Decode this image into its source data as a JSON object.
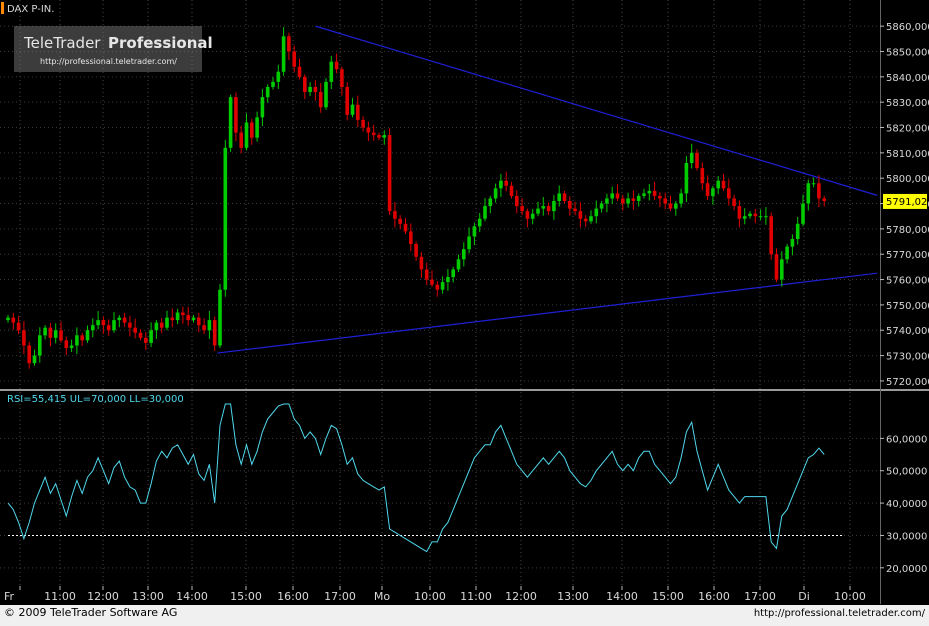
{
  "header": {
    "symbol": "DAX P-IN."
  },
  "logo": {
    "brand": "TeleTrader",
    "product": "Professional",
    "url": "http://professional.teletrader.com/"
  },
  "footer": {
    "copyright": "© 2009 TeleTrader Software AG",
    "url": "http://professional.teletrader.com/"
  },
  "colors": {
    "background": "#000000",
    "up": "#00cc00",
    "down": "#e00000",
    "trendline": "#1f1fd6",
    "rsi": "#4fd8ec",
    "last_price_box": "#ffff00"
  },
  "x_axis": {
    "labels": [
      "Fr",
      "11:00",
      "12:00",
      "13:00",
      "14:00",
      "15:00",
      "16:00",
      "17:00",
      "Mo",
      "10:00",
      "11:00",
      "12:00",
      "13:00",
      "14:00",
      "15:00",
      "16:00",
      "17:00",
      "Di",
      "10:00"
    ]
  },
  "chart_data": [
    {
      "type": "candlestick",
      "symbol": "DAX P-IN.",
      "ylim": [
        5718,
        5864
      ],
      "y_ticks": [
        5720,
        5730,
        5740,
        5750,
        5760,
        5770,
        5780,
        5790,
        5800,
        5810,
        5820,
        5830,
        5840,
        5850,
        5860
      ],
      "y_tick_labels": [
        "5720,000",
        "5730,000",
        "5740,000",
        "5750,000",
        "5760,000",
        "5770,000",
        "5780,000",
        "5790,000",
        "5800,000",
        "5810,000",
        "5820,000",
        "5830,000",
        "5840,000",
        "5850,000",
        "5860,000"
      ],
      "last_price": 5791.02,
      "last_price_label": "5791,02",
      "close": [
        5745,
        5743,
        5740,
        5734,
        5727,
        5730,
        5738,
        5741,
        5737,
        5740,
        5736,
        5733,
        5734,
        5738,
        5736,
        5740,
        5742,
        5744,
        5742,
        5740,
        5744,
        5745,
        5743,
        5741,
        5739,
        5737,
        5735,
        5740,
        5743,
        5741,
        5745,
        5744,
        5747,
        5746,
        5744,
        5745,
        5742,
        5740,
        5744,
        5734,
        5756,
        5812,
        5832,
        5818,
        5812,
        5822,
        5816,
        5824,
        5832,
        5836,
        5838,
        5842,
        5856,
        5850,
        5844,
        5840,
        5834,
        5836,
        5834,
        5828,
        5838,
        5846,
        5843,
        5836,
        5825,
        5829,
        5823,
        5820,
        5818,
        5817,
        5816,
        5817,
        5787,
        5784,
        5782,
        5779,
        5774,
        5769,
        5764,
        5760,
        5758,
        5756,
        5759,
        5761,
        5764,
        5768,
        5772,
        5777,
        5781,
        5784,
        5789,
        5792,
        5796,
        5799,
        5797,
        5793,
        5789,
        5787,
        5784,
        5786,
        5788,
        5789,
        5787,
        5791,
        5794,
        5791,
        5788,
        5787,
        5784,
        5783,
        5785,
        5788,
        5790,
        5792,
        5794,
        5792,
        5790,
        5792,
        5791,
        5793,
        5794,
        5795,
        5793,
        5792,
        5790,
        5788,
        5790,
        5794,
        5806,
        5810,
        5804,
        5798,
        5793,
        5796,
        5799,
        5796,
        5792,
        5789,
        5784,
        5785,
        5786,
        5785,
        5785,
        5785,
        5770,
        5760,
        5768,
        5773,
        5776,
        5782,
        5790,
        5798,
        5798,
        5792,
        5791
      ],
      "trendlines": [
        {
          "from": {
            "bar": 39.5,
            "value": 5731
          },
          "to": {
            "bar": 158,
            "value": 5761
          },
          "note": "lower support"
        },
        {
          "from": {
            "bar": 58,
            "value": 5860
          },
          "to": {
            "bar": 158,
            "value": 5797
          },
          "note": "upper resistance"
        }
      ]
    },
    {
      "type": "line",
      "indicator": "RSI",
      "legend_label": "RSI=55,415 UL=70,000 LL=30,000",
      "value": 55.415,
      "upper_level": 70,
      "lower_level": 30,
      "ylim": [
        15,
        70
      ],
      "y_ticks": [
        20,
        30,
        40,
        50,
        60
      ],
      "y_tick_labels": [
        "20,0000",
        "30,0000",
        "40,0000",
        "50,0000",
        "60,0000"
      ],
      "values": [
        40,
        38,
        34,
        29,
        34,
        40,
        44,
        48,
        43,
        46,
        41,
        36,
        42,
        47,
        43,
        48,
        50,
        54,
        50,
        46,
        51,
        53,
        48,
        45,
        44,
        40,
        40,
        46,
        53,
        56,
        54,
        57,
        58,
        55,
        52,
        55,
        49,
        47,
        52,
        40,
        64,
        80,
        72,
        58,
        52,
        58,
        52,
        56,
        62,
        66,
        68,
        70,
        76,
        72,
        66,
        64,
        60,
        62,
        60,
        55,
        60,
        64,
        63,
        58,
        52,
        54,
        49,
        47,
        46,
        45,
        44,
        45,
        32,
        31,
        30,
        29,
        28,
        27,
        26,
        25,
        28,
        28,
        32,
        34,
        38,
        42,
        46,
        50,
        54,
        56,
        58,
        58,
        62,
        64,
        60,
        56,
        52,
        50,
        48,
        50,
        52,
        54,
        52,
        54,
        56,
        54,
        50,
        48,
        46,
        45,
        47,
        50,
        52,
        54,
        56,
        52,
        50,
        52,
        50,
        54,
        56,
        56,
        52,
        50,
        48,
        46,
        48,
        54,
        62,
        65,
        56,
        50,
        44,
        48,
        52,
        48,
        44,
        42,
        40,
        42,
        42,
        42,
        42,
        42,
        28,
        26,
        36,
        38,
        42,
        46,
        50,
        54,
        55,
        57,
        55
      ]
    }
  ]
}
